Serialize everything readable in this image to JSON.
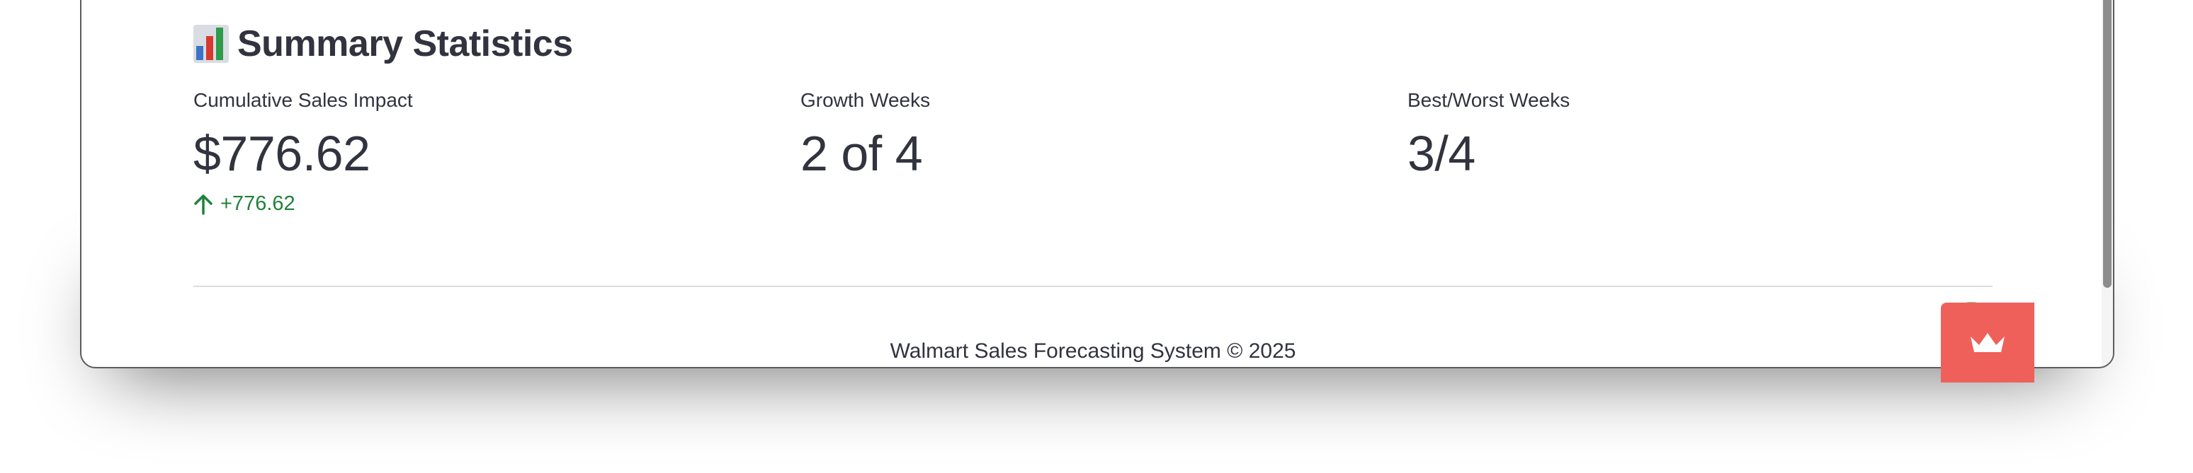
{
  "colors": {
    "text": "#31333f",
    "delta_positive": "#21803a",
    "accent_red": "#f0605a",
    "avatar_bg": "#7bd08a"
  },
  "summary": {
    "icon": "bar-chart-icon",
    "title": "Summary Statistics"
  },
  "metrics": [
    {
      "label": "Cumulative Sales Impact",
      "value": "$776.62",
      "delta": "+776.62",
      "delta_icon": "arrow-up-icon"
    },
    {
      "label": "Growth Weeks",
      "value": "2 of 4"
    },
    {
      "label": "Best/Worst Weeks",
      "value": "3/4"
    }
  ],
  "footer": {
    "text": "Walmart Sales Forecasting System © 2025"
  },
  "widgets": {
    "avatar_icon": "user-avatar-icon",
    "badge_icon": "crown-icon"
  }
}
